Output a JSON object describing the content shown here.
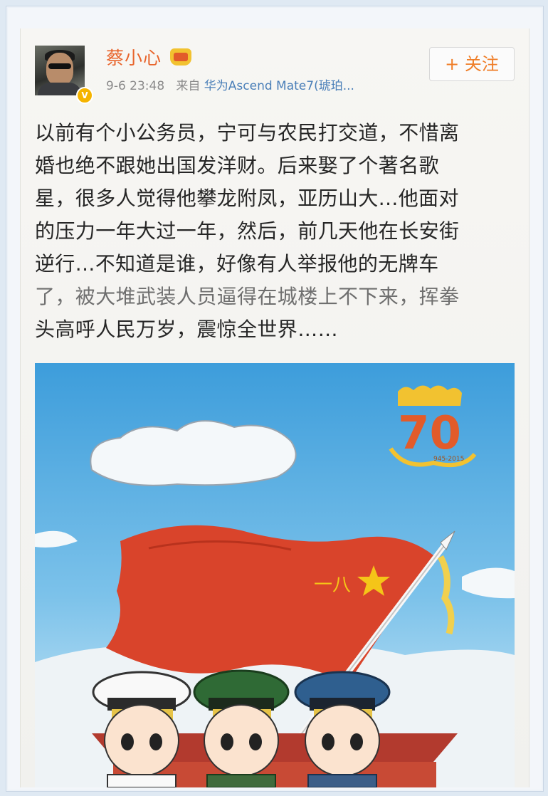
{
  "post": {
    "username": "蔡小心",
    "verified_badge": "V",
    "time": "9-6 23:48",
    "source_prefix": "来自",
    "source": "华为Ascend Mate7(琥珀...",
    "follow_label": "+ 关注",
    "text_lines": [
      "以前有个小公务员，宁可与农民打交道，不惜离",
      "婚也绝不跟她出国发洋财。后来娶了个著名歌",
      "星，很多人觉得他攀龙附凤，亚历山大...他面对",
      "的压力一年大过一年，然后，前几天他在长安街",
      "逆行...不知道是谁，好像有人举报他的无牌车",
      "了，被大堆武装人员逼得在城楼上不下来，挥拳",
      "头高呼人民万岁，震惊全世界……"
    ]
  },
  "image": {
    "flag_text": "一八",
    "logo_number": "70",
    "logo_years": "945-2015"
  },
  "colors": {
    "username": "#e8632a",
    "follow": "#ef7d27",
    "source_link": "#4a7fb8",
    "sky": "#4fa8de",
    "flag": "#d9442b",
    "star": "#f5c518"
  }
}
